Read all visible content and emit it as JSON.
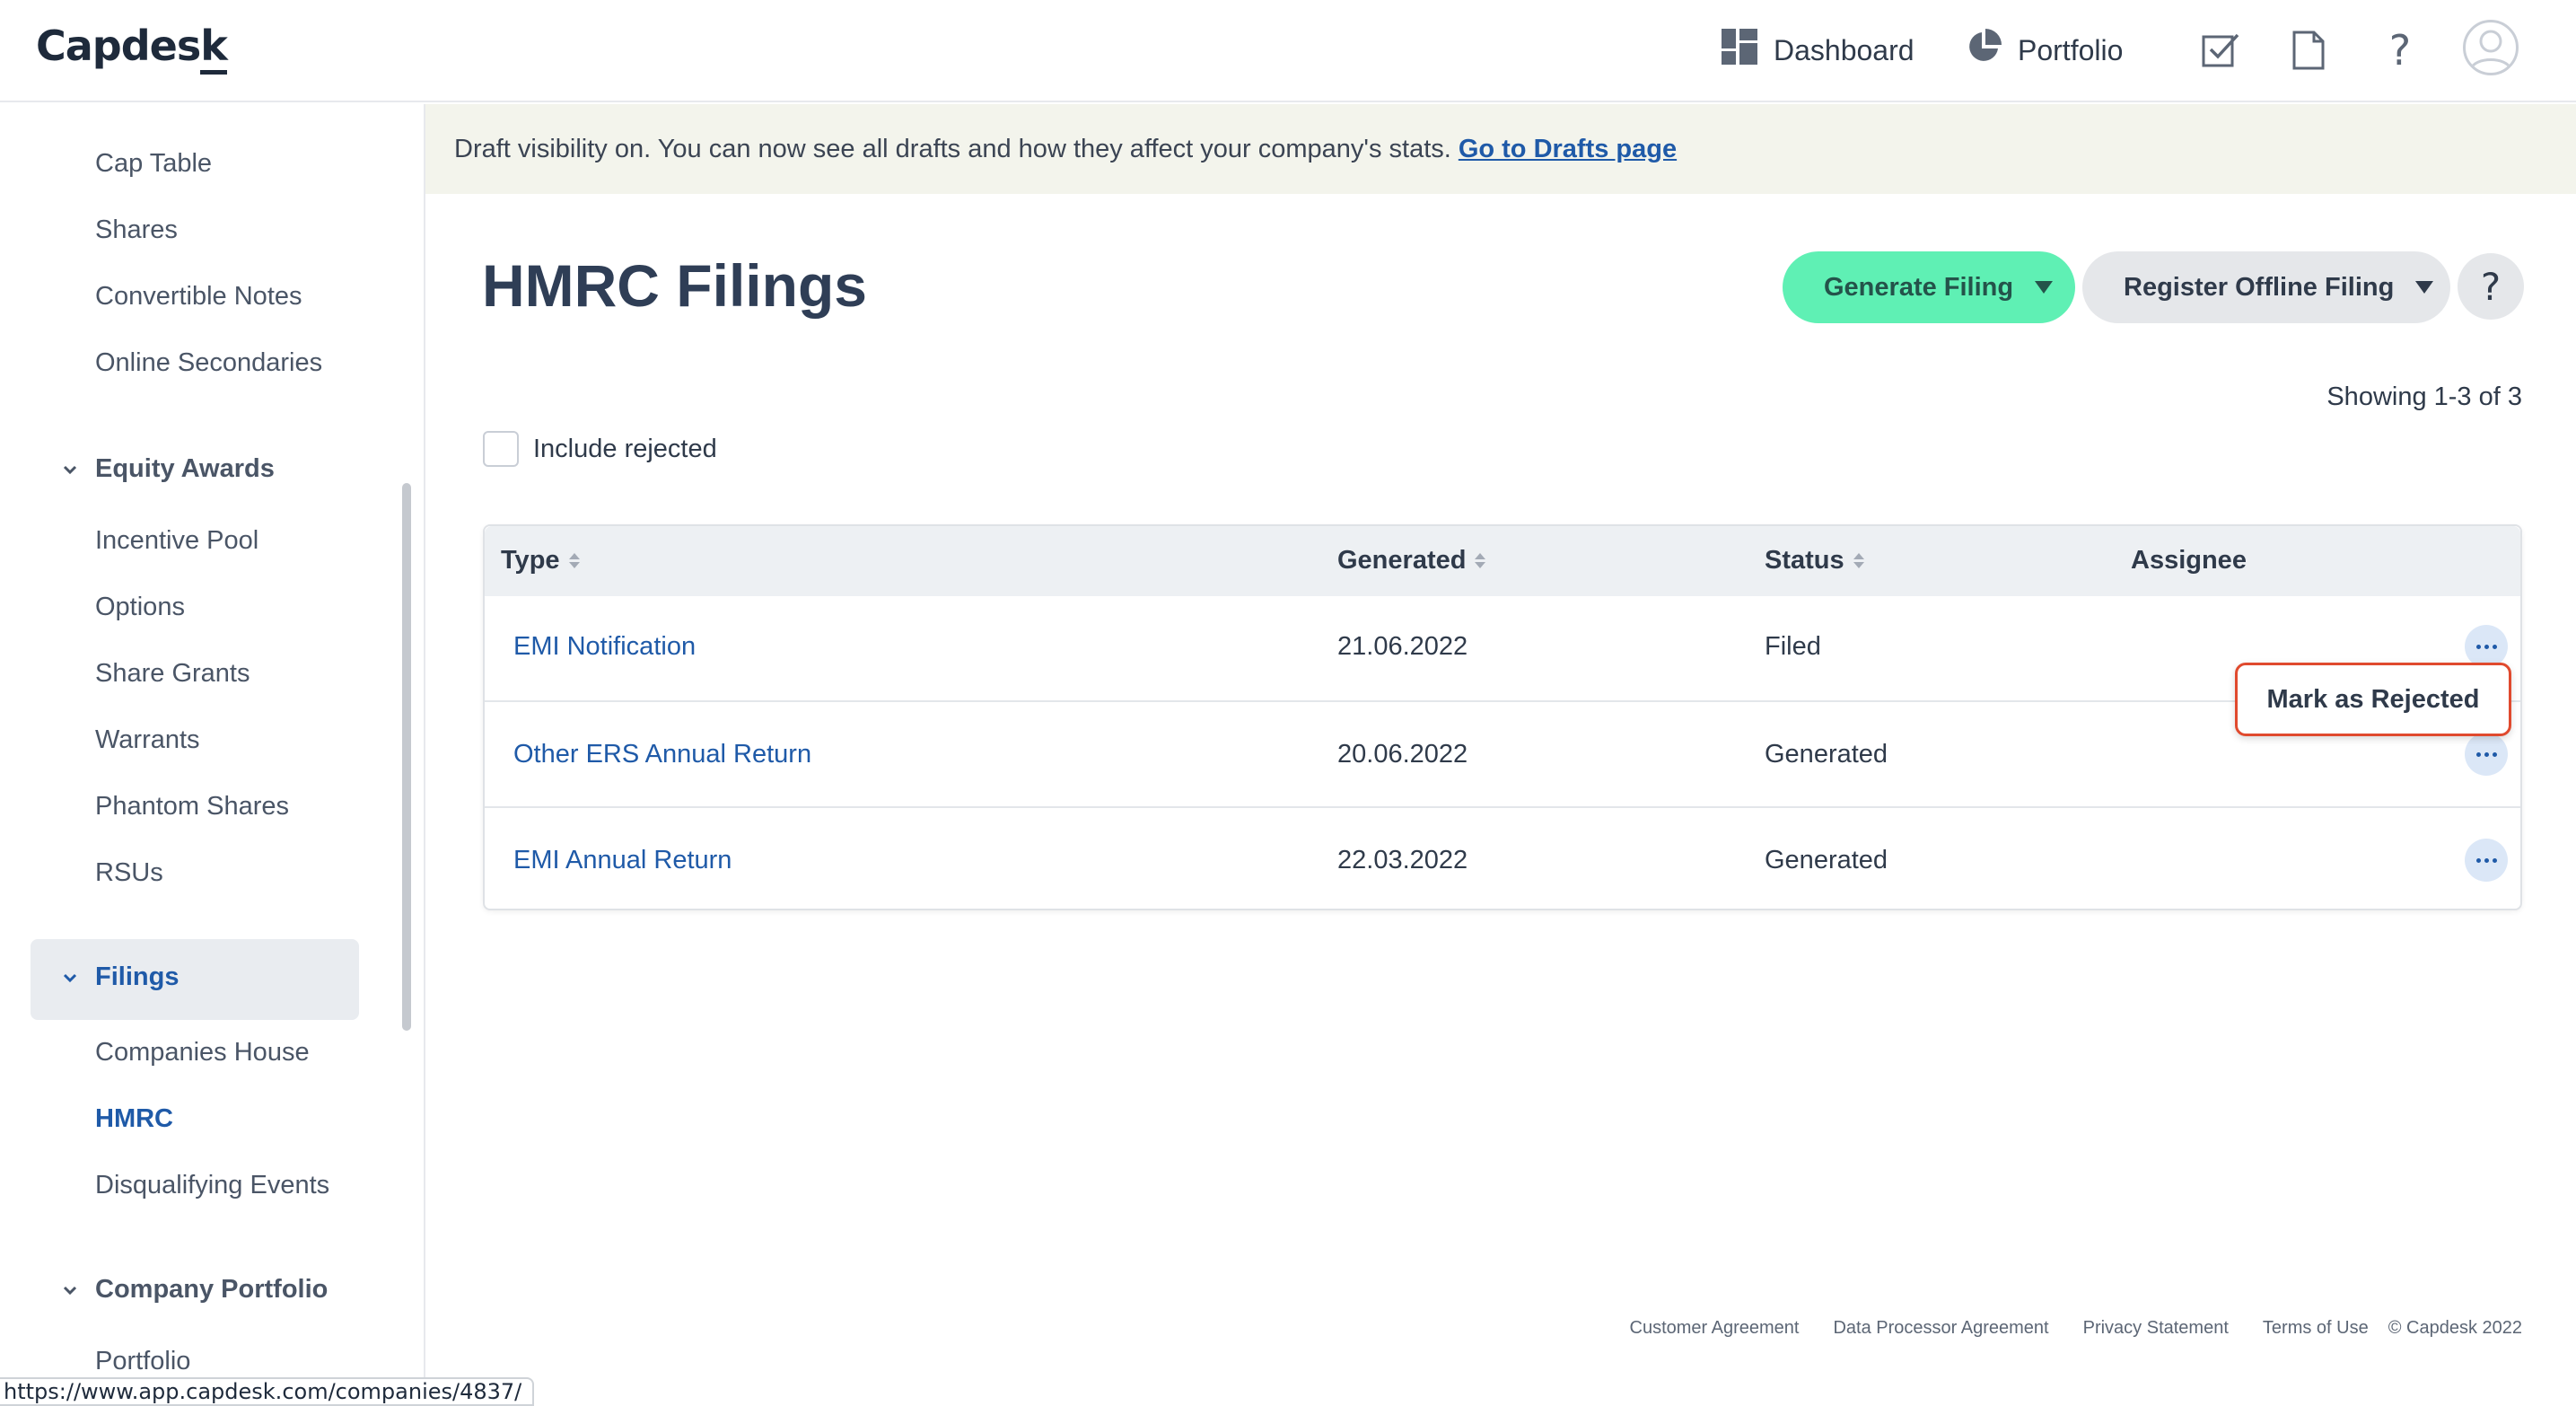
{
  "header": {
    "logo": "Capdes",
    "logo_tail": "k",
    "nav": [
      {
        "label": "Dashboard",
        "icon": "dashboard-grid-icon"
      },
      {
        "label": "Portfolio",
        "icon": "pie-chart-icon"
      }
    ],
    "icons": [
      "tasks-checkbox-icon",
      "document-icon",
      "help-icon",
      "avatar-icon"
    ],
    "help_glyph": "?"
  },
  "sidebar": {
    "items_top": [
      "Cap Table",
      "Shares",
      "Convertible Notes",
      "Online Secondaries"
    ],
    "equity_group": "Equity Awards",
    "equity_items": [
      "Incentive Pool",
      "Options",
      "Share Grants",
      "Warrants",
      "Phantom Shares",
      "RSUs"
    ],
    "filings_group": "Filings",
    "filings_items": [
      "Companies House",
      "HMRC",
      "Disqualifying Events"
    ],
    "portfolio_group": "Company Portfolio",
    "portfolio_items": [
      "Portfolio"
    ]
  },
  "banner": {
    "text": "Draft visibility on. You can now see all drafts and how they affect your company's stats.",
    "link": "Go to Drafts page"
  },
  "main": {
    "title": "HMRC Filings",
    "generate_label": "Generate Filing",
    "offline_label": "Register Offline Filing",
    "help_label": "?",
    "showing": "Showing 1-3 of 3",
    "include_rejected": "Include rejected"
  },
  "table": {
    "headers": [
      "Type",
      "Generated",
      "Status",
      "Assignee"
    ],
    "rows": [
      {
        "type": "EMI Notification",
        "generated": "21.06.2022",
        "status": "Filed",
        "assignee": ""
      },
      {
        "type": "Other ERS Annual Return",
        "generated": "20.06.2022",
        "status": "Generated",
        "assignee": ""
      },
      {
        "type": "EMI Annual Return",
        "generated": "22.03.2022",
        "status": "Generated",
        "assignee": ""
      }
    ]
  },
  "dropdown": {
    "mark_rejected": "Mark as Rejected"
  },
  "footer": {
    "links": [
      "Customer Agreement",
      "Data Processor Agreement",
      "Privacy Statement",
      "Terms of Use"
    ],
    "copyright": "© Capdesk 2022"
  },
  "status_url": "https://www.app.capdesk.com/companies/4837/",
  "colors": {
    "accent": "#1f5aa8",
    "generate_button": "#5ff0b4",
    "highlight_outline": "#e04a2e",
    "banner_bg": "#f3f4ec"
  }
}
